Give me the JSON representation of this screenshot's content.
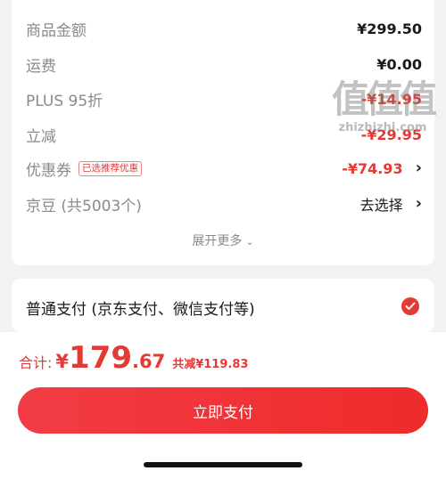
{
  "summary": {
    "rows": [
      {
        "label": "商品金额",
        "value": "¥299.50"
      },
      {
        "label": "运费",
        "value": "¥0.00"
      },
      {
        "label": "PLUS 95折",
        "value": "-¥14.95"
      },
      {
        "label": "立减",
        "value": "-¥29.95"
      },
      {
        "label": "优惠券",
        "tag": "已选推荐优惠",
        "value": "-¥74.93"
      },
      {
        "label": "京豆 (共5003个)",
        "value": "去选择"
      }
    ],
    "expand_label": "展开更多"
  },
  "payment": {
    "method_label": "普通支付 (京东支付、微信支付等)"
  },
  "footer": {
    "total_label": "合计:",
    "currency": "¥",
    "total_integer": "179",
    "total_decimal": ".67",
    "saved_text": "共减¥119.83",
    "pay_button_label": "立即支付"
  },
  "watermark": {
    "big": "值值值",
    "small": "zhizhizhi.com"
  },
  "colors": {
    "accent": "#e53935",
    "background": "#f2f2f2"
  }
}
